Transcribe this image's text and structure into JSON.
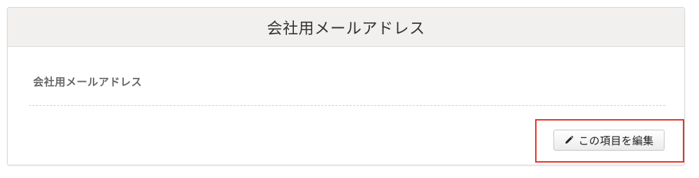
{
  "panel": {
    "title": "会社用メールアドレス",
    "field_label": "会社用メールアドレス"
  },
  "actions": {
    "edit_label": "この項目を編集",
    "edit_icon": "pencil-icon"
  },
  "colors": {
    "highlight": "#e0362a",
    "header_bg": "#f1f0ee"
  }
}
